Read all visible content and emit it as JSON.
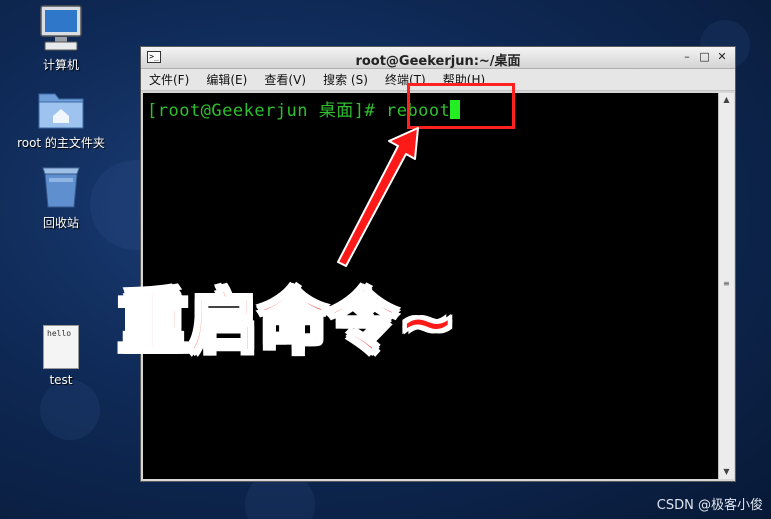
{
  "desktop": {
    "icons": [
      {
        "label": "计算机",
        "icon": "computer-icon"
      },
      {
        "label": "root 的主文件夹",
        "icon": "home-folder-icon"
      },
      {
        "label": "回收站",
        "icon": "trash-icon"
      },
      {
        "label": "test",
        "icon": "text-file-icon",
        "file_preview": "hello"
      }
    ]
  },
  "window": {
    "title": "root@Geekerjun:~/桌面",
    "controls": {
      "minimize": "–",
      "maximize": "□",
      "close": "✕"
    },
    "menu": [
      "文件(F)",
      "编辑(E)",
      "查看(V)",
      "搜索 (S)",
      "终端(T)",
      "帮助(H)"
    ]
  },
  "terminal": {
    "prompt": "[root@Geekerjun 桌面]# ",
    "command": "reboot"
  },
  "annotation": {
    "caption": "重启命令~",
    "color": "#ff1a1a"
  },
  "watermark": "CSDN @极客小俊"
}
